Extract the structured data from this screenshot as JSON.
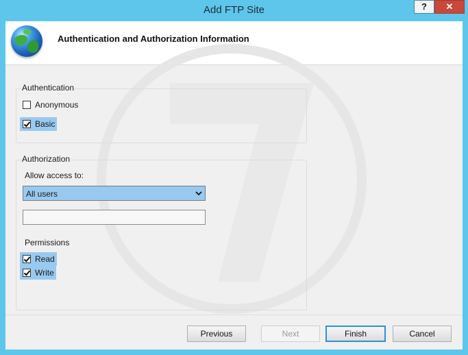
{
  "window": {
    "title": "Add FTP Site",
    "help_label": "?",
    "close_label": "✕"
  },
  "header": {
    "title": "Authentication and Authorization Information",
    "icon": "globe-icon"
  },
  "authentication": {
    "group_title": "Authentication",
    "options": [
      {
        "label": "Anonymous",
        "checked": false
      },
      {
        "label": "Basic",
        "checked": true
      }
    ]
  },
  "authorization": {
    "group_title": "Authorization",
    "allow_access_label": "Allow access to:",
    "allow_access_selected": "All users",
    "users_field_value": "",
    "permissions_label": "Permissions",
    "permissions": [
      {
        "label": "Read",
        "checked": true
      },
      {
        "label": "Write",
        "checked": true
      }
    ]
  },
  "buttons": {
    "previous": "Previous",
    "next": "Next",
    "finish": "Finish",
    "cancel": "Cancel"
  },
  "colors": {
    "frame": "#5ec6ea",
    "selection": "#99c9ef",
    "default_button_border": "#2f8fd8"
  }
}
